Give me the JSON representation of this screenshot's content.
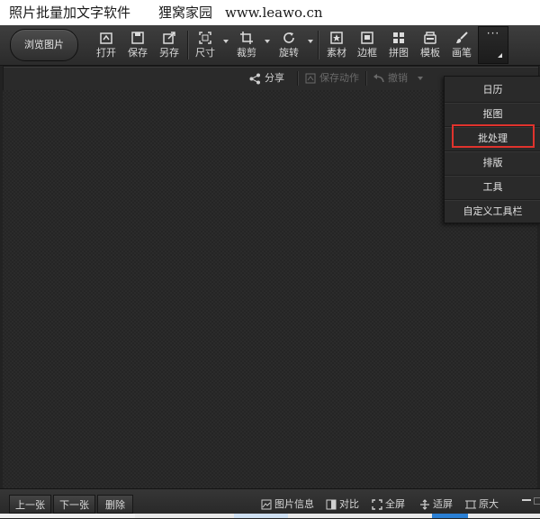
{
  "caption": {
    "title": "照片批量加文字软件",
    "site_name": "狸窝家园",
    "url": "www.leawo.cn"
  },
  "toolbar": {
    "browse_label": "浏览图片",
    "tools": [
      {
        "label": "打开",
        "icon": "open-icon"
      },
      {
        "label": "保存",
        "icon": "save-icon"
      },
      {
        "label": "另存",
        "icon": "save-as-icon"
      },
      {
        "label": "尺寸",
        "icon": "resize-icon"
      },
      {
        "label": "裁剪",
        "icon": "crop-icon"
      },
      {
        "label": "旋转",
        "icon": "rotate-icon"
      },
      {
        "label": "素材",
        "icon": "sticker-icon"
      },
      {
        "label": "边框",
        "icon": "frame-icon"
      },
      {
        "label": "拼图",
        "icon": "collage-icon"
      },
      {
        "label": "模板",
        "icon": "template-icon"
      },
      {
        "label": "画笔",
        "icon": "brush-icon"
      }
    ],
    "more_label": "···"
  },
  "subbar": {
    "share": "分享",
    "save_action": "保存动作",
    "undo": "撤销"
  },
  "dropdown": {
    "items": [
      "日历",
      "抠图",
      "批处理",
      "排版",
      "工具",
      "自定义工具栏"
    ],
    "highlighted_index": 2,
    "highlight_color": "#e0332d"
  },
  "statusbar": {
    "prev": "上一张",
    "next": "下一张",
    "delete": "删除",
    "info": "图片信息",
    "compare": "对比",
    "fullscreen": "全屏",
    "fit": "适屏",
    "original": "原大"
  },
  "colors": {
    "toolbar_bg": "#333333",
    "canvas_bg": "#252525",
    "text": "#d8d8d8",
    "accent_red": "#e0332d"
  }
}
